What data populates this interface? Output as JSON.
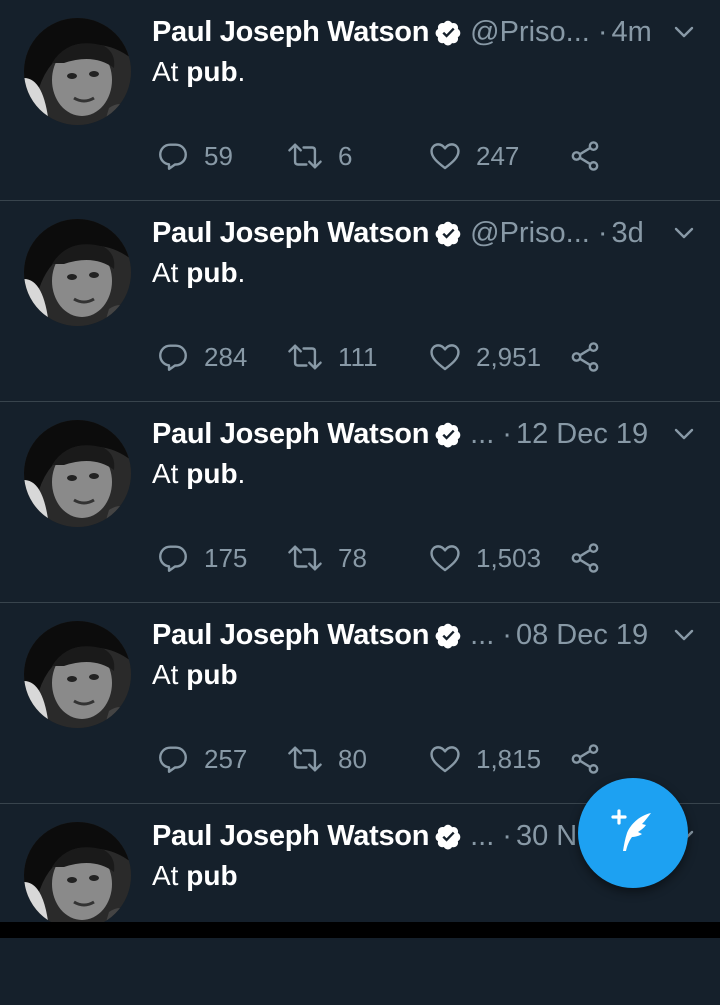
{
  "tweets": [
    {
      "name": "Paul Joseph Watson",
      "handle": "@Priso...",
      "sep": "·",
      "time": "4m",
      "text_prefix": "At ",
      "text_bold": "pub",
      "text_suffix": ".",
      "replies": "59",
      "retweets": "6",
      "likes": "247"
    },
    {
      "name": "Paul Joseph Watson",
      "handle": "@Priso...",
      "sep": "·",
      "time": "3d",
      "text_prefix": "At ",
      "text_bold": "pub",
      "text_suffix": ".",
      "replies": "284",
      "retweets": "111",
      "likes": "2,951"
    },
    {
      "name": "Paul Joseph Watson",
      "handle": "...",
      "sep": "·",
      "time": "12 Dec 19",
      "text_prefix": "At ",
      "text_bold": "pub",
      "text_suffix": ".",
      "replies": "175",
      "retweets": "78",
      "likes": "1,503"
    },
    {
      "name": "Paul Joseph Watson",
      "handle": "...",
      "sep": "·",
      "time": "08 Dec 19",
      "text_prefix": "At ",
      "text_bold": "pub",
      "text_suffix": "",
      "replies": "257",
      "retweets": "80",
      "likes": "1,815"
    },
    {
      "name": "Paul Joseph Watson",
      "handle": "...",
      "sep": "·",
      "time": "30 N",
      "text_prefix": "At ",
      "text_bold": "pub",
      "text_suffix": "",
      "replies": "",
      "retweets": "",
      "likes": ""
    }
  ],
  "colors": {
    "background": "#15202b",
    "muted": "#8899a6",
    "accent": "#1da1f2",
    "divider": "#38444d"
  },
  "icons": {
    "verified": "verified-badge-icon",
    "reply": "reply-icon",
    "retweet": "retweet-icon",
    "like": "heart-icon",
    "share": "share-icon",
    "menu": "chevron-down-icon",
    "compose": "compose-tweet-icon"
  }
}
